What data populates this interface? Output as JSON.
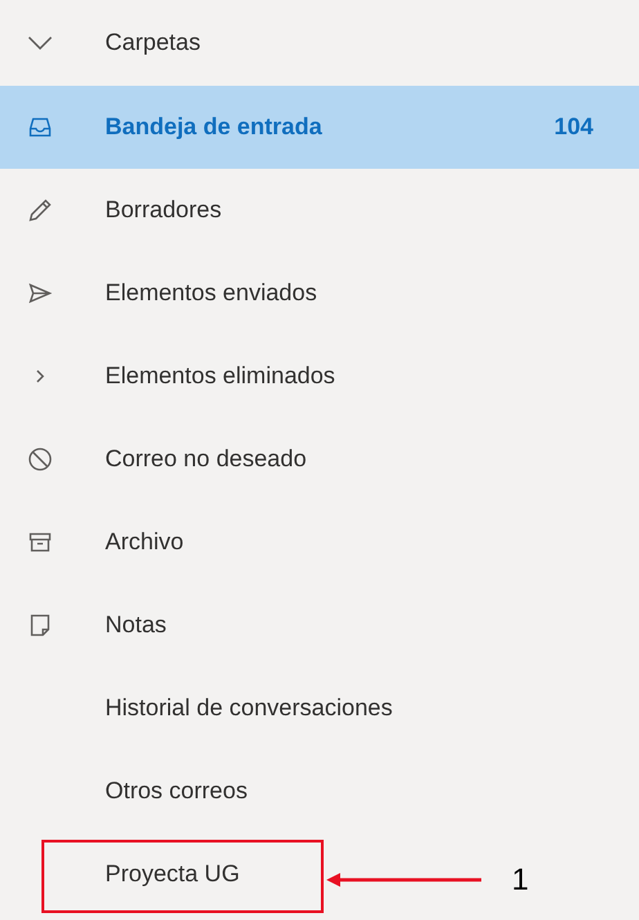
{
  "section": {
    "title": "Carpetas",
    "expanded": true
  },
  "folders": [
    {
      "name": "Bandeja de entrada",
      "kind": "inbox",
      "count": "104",
      "selected": true
    },
    {
      "name": "Borradores",
      "kind": "drafts",
      "selected": false
    },
    {
      "name": "Elementos enviados",
      "kind": "sent",
      "selected": false
    },
    {
      "name": "Elementos eliminados",
      "kind": "collapsible",
      "selected": false
    },
    {
      "name": "Correo no deseado",
      "kind": "junk",
      "selected": false
    },
    {
      "name": "Archivo",
      "kind": "archive",
      "selected": false
    },
    {
      "name": "Notas",
      "kind": "notes",
      "selected": false
    },
    {
      "name": "Historial de conversaciones",
      "kind": "plain",
      "selected": false
    },
    {
      "name": "Otros correos",
      "kind": "plain",
      "selected": false
    },
    {
      "name": "Proyecta UG",
      "kind": "plain",
      "selected": false,
      "annotated": true
    }
  ],
  "annotation": {
    "label": "1"
  }
}
